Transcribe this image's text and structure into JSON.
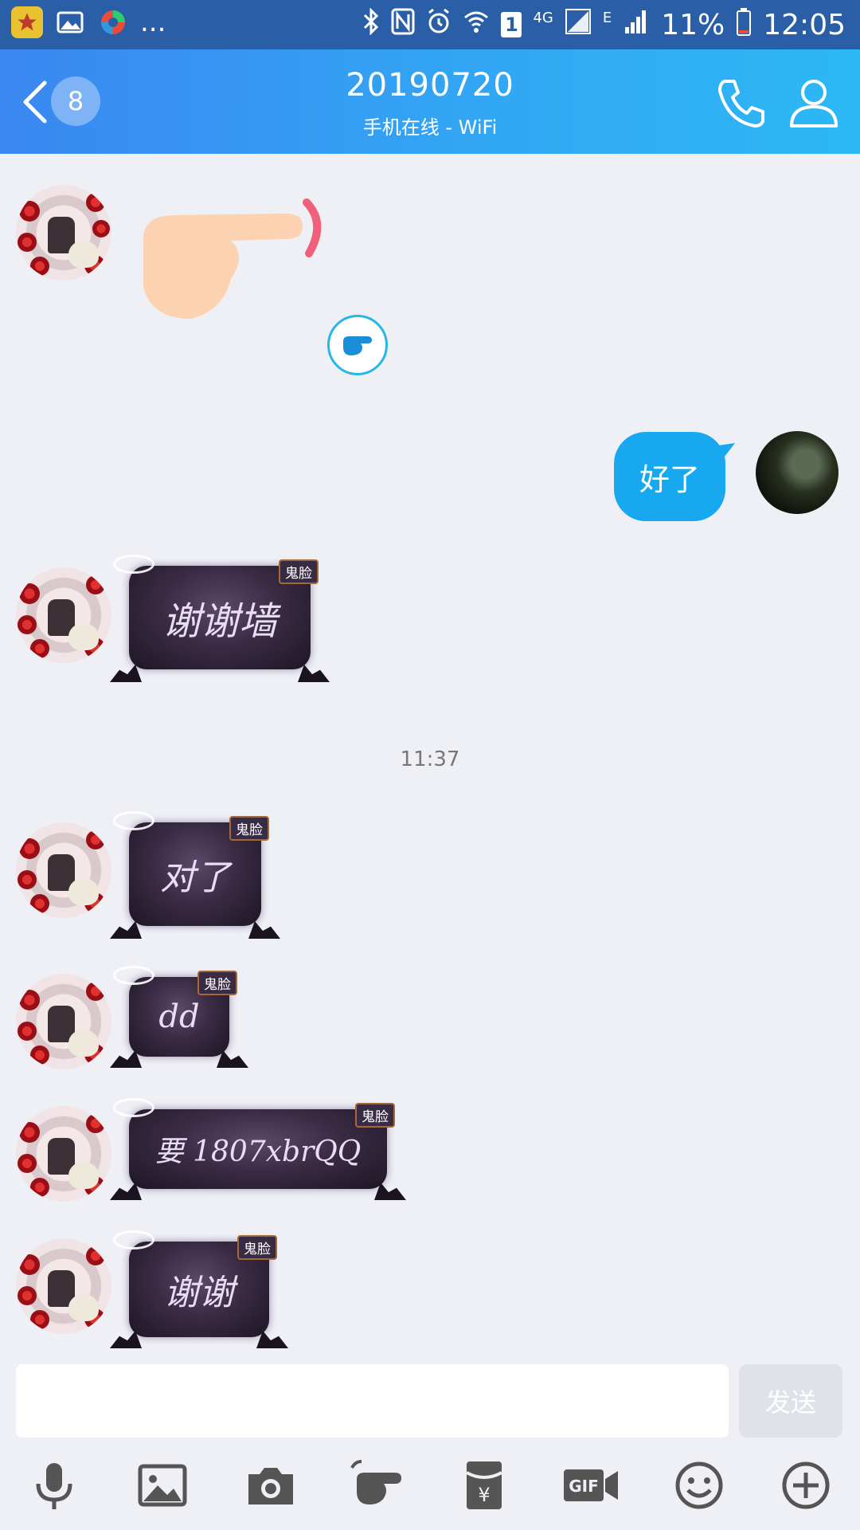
{
  "status_bar": {
    "dots": "...",
    "sim_label": "1",
    "network_4g": "4G",
    "network_e": "E",
    "battery": "11%",
    "time": "12:05"
  },
  "header": {
    "unread_count": "8",
    "title": "20190720",
    "subtitle": "手机在线 - WiFi"
  },
  "messages": [
    {
      "from": "other",
      "type": "sticker",
      "icon": "pointing-hand-sticker"
    },
    {
      "from": "self",
      "type": "text",
      "text": "好了"
    },
    {
      "from": "other",
      "type": "ghost-bubble",
      "text": "谢谢墙",
      "tag": "鬼脸"
    },
    {
      "type": "timestamp",
      "text": "11:37"
    },
    {
      "from": "other",
      "type": "ghost-bubble",
      "text": "对了",
      "tag": "鬼脸"
    },
    {
      "from": "other",
      "type": "ghost-bubble",
      "text": "dd",
      "tag": "鬼脸"
    },
    {
      "from": "other",
      "type": "ghost-bubble",
      "text": "要 1807xbrQQ",
      "tag": "鬼脸"
    },
    {
      "from": "other",
      "type": "ghost-bubble",
      "text": "谢谢",
      "tag": "鬼脸"
    }
  ],
  "input": {
    "placeholder": "",
    "send_label": "发送"
  },
  "toolbar": [
    "microphone-icon",
    "image-icon",
    "camera-icon",
    "poke-icon",
    "red-packet-icon",
    "gif-icon",
    "emoji-icon",
    "plus-icon"
  ],
  "colors": {
    "header_start": "#3a87f0",
    "header_end": "#2cb8f5",
    "self_bubble": "#17a8f0",
    "background": "#eef0f6",
    "ghost_bubble": "#3a2b45"
  }
}
